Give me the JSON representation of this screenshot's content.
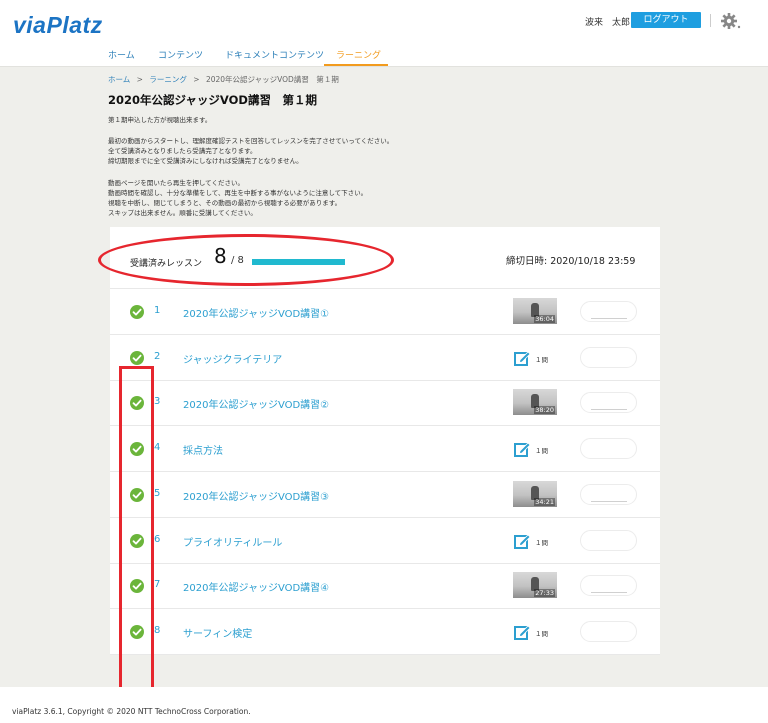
{
  "header": {
    "logo": "viaPlatz",
    "user_name": "波来　太郎",
    "logout_label": "ログアウト",
    "settings_icon": "gear-icon"
  },
  "nav": {
    "items": [
      {
        "label": "ホーム"
      },
      {
        "label": "コンテンツ"
      },
      {
        "label": "ドキュメントコンテンツ"
      },
      {
        "label": "ラーニング",
        "active": true
      }
    ]
  },
  "breadcrumb": {
    "items": [
      "ホーム",
      "ラーニング",
      "2020年公認ジャッジVOD講習　第１期"
    ],
    "separator": ">"
  },
  "page": {
    "title": "2020年公認ジャッジVOD講習　第１期",
    "description": [
      "第１期申込した方が視聴出来ます。",
      "",
      "最初の動画からスタートし、理解度確認テストを回答してレッスンを完了させていってください。",
      "全て受講済みとなりましたら受講完了となります。",
      "締切期限までに全て受講済みにしなければ受講完了となりません。",
      "",
      "動画ページを開いたら再生を押してください。",
      "動画時間を確認し、十分な準備をして、再生を中断する事がないように注意して下さい。",
      "視聴を中断し、閉じてしまうと、その動画の最初から視聴する必要があります。",
      "スキップは出来ません。順番に受講してください。"
    ]
  },
  "summary": {
    "label": "受講済みレッスン",
    "completed": "8",
    "total": "/ 8",
    "progress": 1.0,
    "progress_color": "#20b9cf",
    "deadline": "締切日時: 2020/10/18 23:59"
  },
  "lessons": [
    {
      "num": "1",
      "title": "2020年公認ジャッジVOD講習①",
      "type": "video",
      "duration": "36:04"
    },
    {
      "num": "2",
      "title": "ジャッジクライテリア",
      "type": "quiz",
      "quiz_label": "１問"
    },
    {
      "num": "3",
      "title": "2020年公認ジャッジVOD講習②",
      "type": "video",
      "duration": "38:20"
    },
    {
      "num": "4",
      "title": "採点方法",
      "type": "quiz",
      "quiz_label": "１問"
    },
    {
      "num": "5",
      "title": "2020年公認ジャッジVOD講習③",
      "type": "video",
      "duration": "34:21"
    },
    {
      "num": "6",
      "title": "プライオリティルール",
      "type": "quiz",
      "quiz_label": "１問"
    },
    {
      "num": "7",
      "title": "2020年公認ジャッジVOD講習④",
      "type": "video",
      "duration": "27:33"
    },
    {
      "num": "8",
      "title": "サーフィン検定",
      "type": "quiz",
      "quiz_label": "１問"
    }
  ],
  "colors": {
    "brand": "#1c74c4",
    "accent": "#f29b1e",
    "link": "#2c9fd0",
    "check": "#6bb53b",
    "annotation": "#e6262e"
  },
  "footer": {
    "copyright": "viaPlatz 3.6.1, Copyright © 2020 NTT TechnoCross Corporation."
  }
}
